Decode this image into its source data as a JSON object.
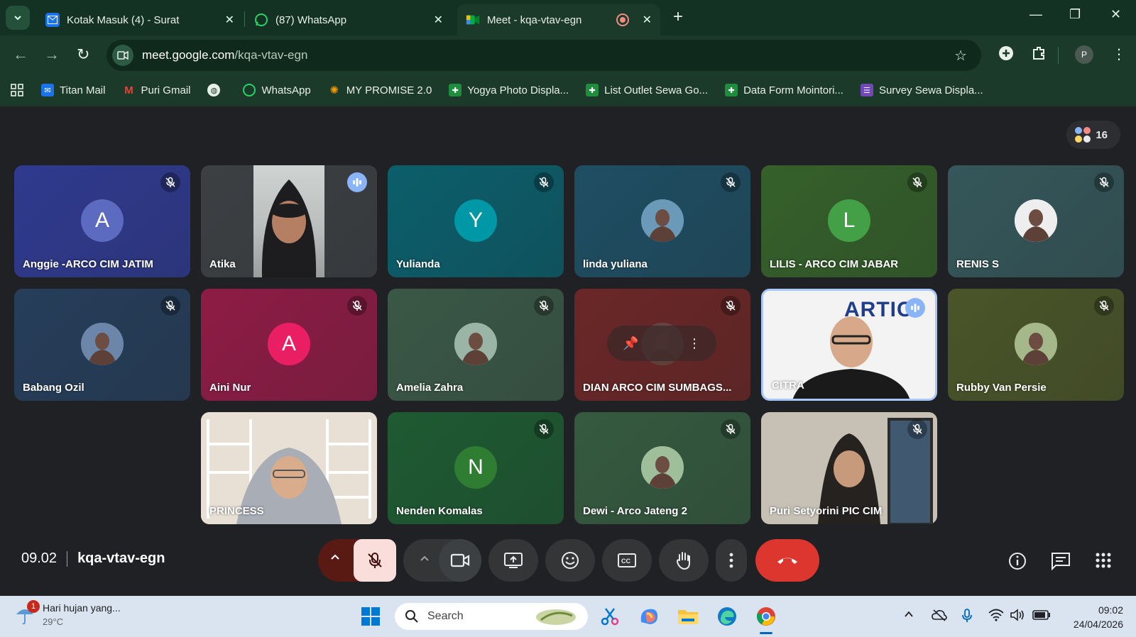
{
  "browser": {
    "tabs": [
      {
        "label": "Kotak Masuk (4) - Surat",
        "icon": "mail-icon",
        "color": "#1a73e8"
      },
      {
        "label": "(87) WhatsApp",
        "icon": "whatsapp-icon",
        "color": "#25d366"
      },
      {
        "label": "Meet - kqa-vtav-egn",
        "icon": "meet-icon",
        "color": "#00832d",
        "active": true
      }
    ],
    "url_domain": "meet.google.com",
    "url_path": "/kqa-vtav-egn",
    "profile_initial": "P",
    "bookmarks": [
      {
        "label": "Titan Mail",
        "icon": "mail-icon",
        "color": "#1a73e8"
      },
      {
        "label": "Puri Gmail",
        "icon": "gmail-icon",
        "color": "#ea4335"
      },
      {
        "label": "",
        "icon": "globe-icon",
        "color": "#ffffff"
      },
      {
        "label": "WhatsApp",
        "icon": "whatsapp-icon",
        "color": "#25d366"
      },
      {
        "label": "MY PROMISE 2.0",
        "icon": "promise-icon",
        "color": "#f29900"
      },
      {
        "label": "Yogya Photo Displa...",
        "icon": "sheets-icon",
        "color": "#1e8e3e"
      },
      {
        "label": "List Outlet Sewa Go...",
        "icon": "sheets-icon",
        "color": "#1e8e3e"
      },
      {
        "label": "Data Form Mointori...",
        "icon": "sheets-icon",
        "color": "#1e8e3e"
      },
      {
        "label": "Survey Sewa Displa...",
        "icon": "forms-icon",
        "color": "#7248b9"
      }
    ]
  },
  "meet": {
    "participant_count": "16",
    "meeting_time": "09.02",
    "meeting_code": "kqa-vtav-egn",
    "tiles": [
      {
        "name": "Anggie -ARCO CIM JATIM",
        "initial": "A",
        "bg": "#2f3a8f",
        "avatar_color": "#5c6bc0",
        "mic": "muted"
      },
      {
        "name": "Atika",
        "initial": "",
        "bg": "#3c4043",
        "avatar_color": "#555",
        "mic": "speaking",
        "video": true
      },
      {
        "name": "Yulianda",
        "initial": "Y",
        "bg": "#0b5e6b",
        "avatar_color": "#0097a7",
        "mic": "muted"
      },
      {
        "name": "linda yuliana",
        "initial": "",
        "bg": "#1f4e63",
        "avatar_color": "#6a9ab8",
        "mic": "muted",
        "photo": true
      },
      {
        "name": "LILIS - ARCO CIM JABAR",
        "initial": "L",
        "bg": "#35602a",
        "avatar_color": "#43a047",
        "mic": "muted"
      },
      {
        "name": "RENIS S",
        "initial": "",
        "bg": "#35575a",
        "avatar_color": "#eeeeee",
        "mic": "muted",
        "photo": true
      },
      {
        "name": "Babang Ozil",
        "initial": "",
        "bg": "#263e5a",
        "avatar_color": "#6b86a8",
        "mic": "muted",
        "photo": true
      },
      {
        "name": "Aini Nur",
        "initial": "A",
        "bg": "#8e1c45",
        "avatar_color": "#e91e63",
        "mic": "muted"
      },
      {
        "name": "Amelia Zahra",
        "initial": "",
        "bg": "#3a5846",
        "avatar_color": "#9ab5a5",
        "mic": "muted",
        "photo": true
      },
      {
        "name": "DIAN ARCO CIM SUMBAGS...",
        "initial": "",
        "bg": "#6b2727",
        "avatar_color": "#664444",
        "mic": "muted",
        "photo": true,
        "hover": true
      },
      {
        "name": "CITRA",
        "initial": "",
        "bg": "#f1f1f1",
        "avatar_color": "#222",
        "mic": "speaking",
        "video": true,
        "logo": "ARTICI"
      },
      {
        "name": "Rubby Van Persie",
        "initial": "",
        "bg": "#4a5528",
        "avatar_color": "#a5b88a",
        "mic": "muted",
        "photo": true
      },
      {
        "name": "PRINCESS",
        "initial": "",
        "bg": "#d8cdbd",
        "avatar_color": "#8d8f95",
        "mic": "none",
        "video": true
      },
      {
        "name": "Nenden Komalas",
        "initial": "N",
        "bg": "#1e5a32",
        "avatar_color": "#2e7d32",
        "mic": "muted"
      },
      {
        "name": "Dewi - Arco Jateng 2",
        "initial": "",
        "bg": "#355a3f",
        "avatar_color": "#9fbf9a",
        "mic": "muted",
        "photo": true
      },
      {
        "name": "Puri Setyorini PIC CIM",
        "initial": "",
        "bg": "#5a5e66",
        "avatar_color": "#333",
        "mic": "muted",
        "video": true
      }
    ]
  },
  "taskbar": {
    "weather_text": "Hari hujan yang...",
    "weather_temp": "29°C",
    "weather_badge": "1",
    "search_placeholder": "Search",
    "time": "09:02",
    "date": "24/04/2026"
  }
}
